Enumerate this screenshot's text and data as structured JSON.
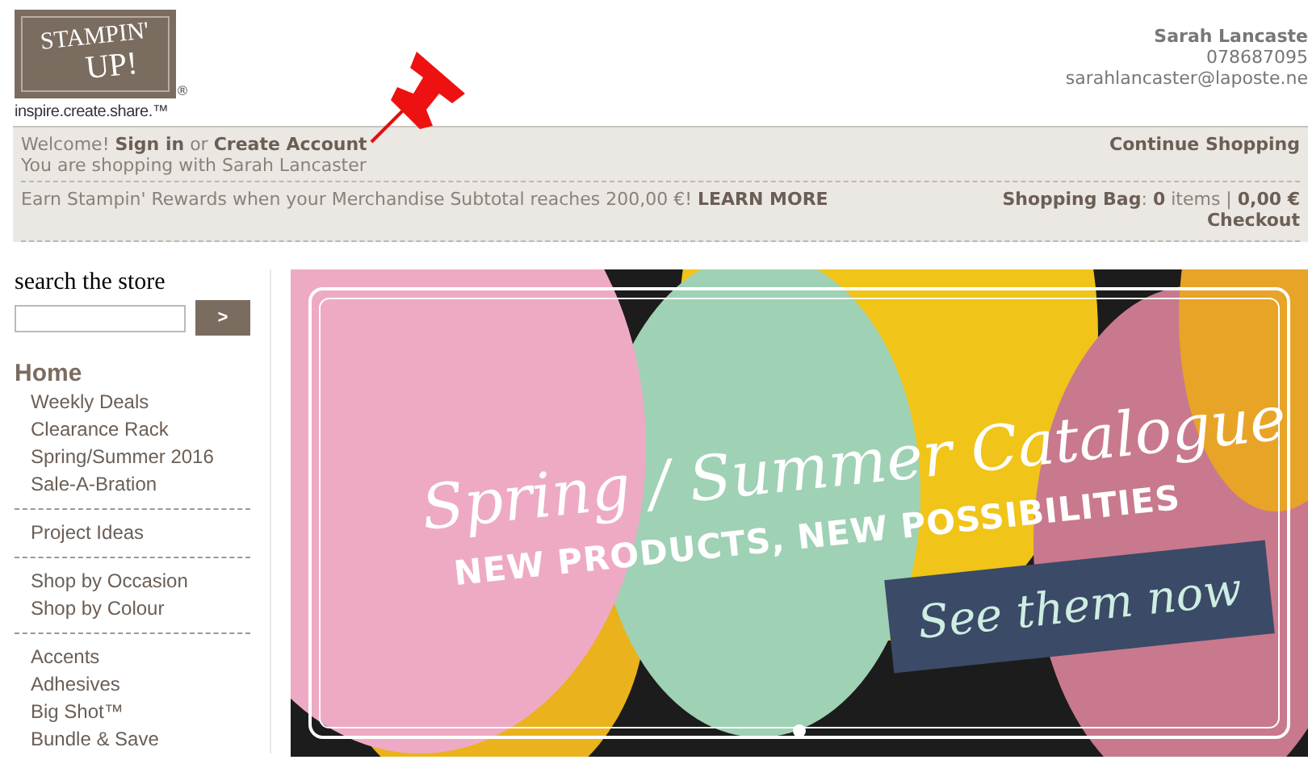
{
  "logo": {
    "wordmark_top": "STAMPIN'",
    "wordmark_bottom": "UP!",
    "registered": "®",
    "tagline": "inspire.create.share.™"
  },
  "contact": {
    "name": "Sarah Lancaste",
    "phone": "078687095",
    "email": "sarahlancaster@laposte.ne"
  },
  "info_bar": {
    "greeting": "Welcome!",
    "sign_in": "Sign in",
    "or": "or",
    "create_account": "Create Account",
    "shopping_with": "You are shopping with Sarah Lancaster",
    "continue_shopping": "Continue Shopping",
    "rewards": "Earn Stampin' Rewards when your Merchandise Subtotal reaches 200,00 €!",
    "learn_more": "LEARN MORE",
    "bag": "**Shopping Bag**: **0** items | **0,00 €**",
    "checkout": "Checkout"
  },
  "sidebar": {
    "search_label": "search the store",
    "search_button": ">",
    "home": "Home",
    "groups": [
      [
        "Weekly Deals",
        "Clearance Rack",
        "Spring/Summer 2016",
        "Sale-A-Bration"
      ],
      [
        "Project Ideas"
      ],
      [
        "Shop by Occasion",
        "Shop by Colour"
      ],
      [
        "Accents",
        "Adhesives",
        "Big Shot™",
        "Bundle & Save"
      ]
    ]
  },
  "banner": {
    "title": "Spring / Summer Catalogue",
    "subtitle": "NEW PRODUCTS, NEW POSSIBILITIES",
    "ribbon": "See them now",
    "slides": [
      {
        "selected": true
      }
    ]
  }
}
